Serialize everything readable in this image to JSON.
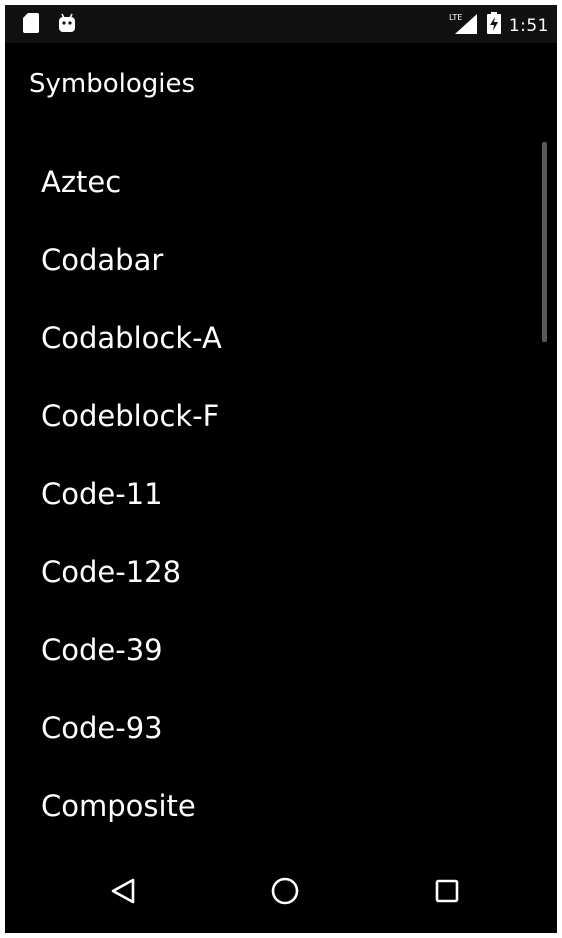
{
  "status_bar": {
    "left_icons": [
      "sd-card-icon",
      "android-icon"
    ],
    "signal_label": "LTE",
    "time": "1:51"
  },
  "toolbar": {
    "title": "Symbologies"
  },
  "list": {
    "items": [
      "Aztec",
      "Codabar",
      "Codablock-A",
      "Codeblock-F",
      "Code-11",
      "Code-128",
      "Code-39",
      "Code-93",
      "Composite"
    ]
  },
  "nav_bar": {
    "buttons": [
      "back-icon",
      "home-icon",
      "recents-icon"
    ]
  },
  "colors": {
    "background": "#000000",
    "text": "#ffffff",
    "status_bar": "#111111",
    "scrollbar": "#5a5a5a"
  }
}
